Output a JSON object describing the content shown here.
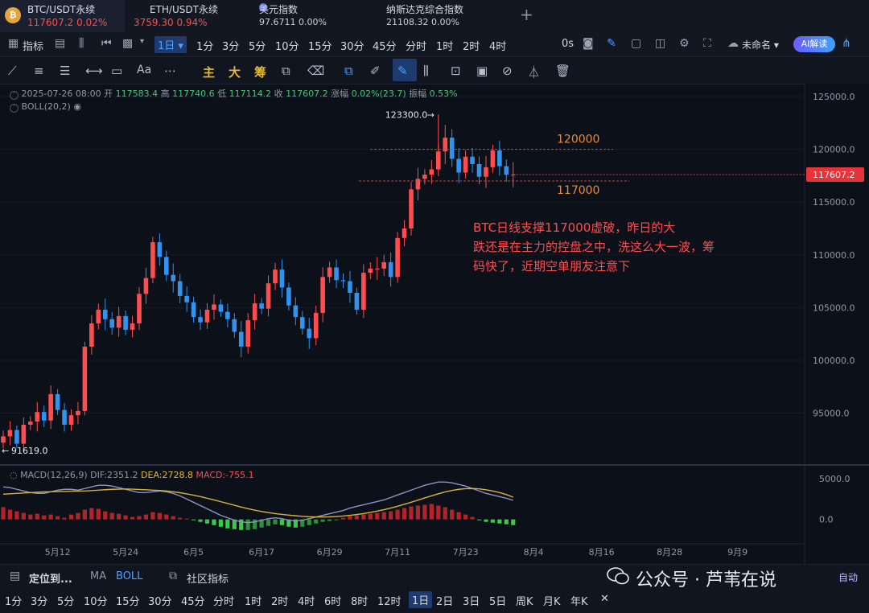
{
  "tabs": [
    {
      "name": "BTC/USDT永续",
      "price": "117607.2",
      "change": "0.02%",
      "color": "#ff4d4f",
      "icon": "bitcoin-icon"
    },
    {
      "name": "ETH/USDT永续",
      "price": "3759.30",
      "change": "0.94%",
      "color": "#ff4d4f"
    },
    {
      "name": "美元指数",
      "price": "97.6711",
      "change": "0.00%",
      "color": "#c9ced8"
    },
    {
      "name": "纳斯达克综合指数",
      "price": "21108.32",
      "change": "0.00%",
      "color": "#c9ced8"
    }
  ],
  "toolbar": {
    "indicator_label": "指标",
    "interval_selected": "1日",
    "intervals": [
      "1分",
      "3分",
      "5分",
      "10分",
      "15分",
      "30分",
      "45分",
      "分时",
      "1时",
      "2时",
      "4时"
    ],
    "zero_s": "0s",
    "layout_name": "未命名",
    "ai_label": "AI解读"
  },
  "drawbar": {
    "main": "主",
    "big": "大",
    "chips": "筹",
    "text_tool": "Aa"
  },
  "ohlc": {
    "date": "2025-07-26 08:00",
    "open_label": "开",
    "open": "117583.4",
    "high_label": "高",
    "high": "117740.6",
    "low_label": "低",
    "low": "117114.2",
    "close_label": "收",
    "close": "117607.2",
    "chg_label": "涨幅",
    "chg": "0.02%(23.7)",
    "amp_label": "振幅",
    "amp": "0.53%"
  },
  "boll_label": "BOLL(20,2)",
  "macd": {
    "label": "MACD(12,26,9)",
    "dif": "DIF:2351.2",
    "dea": "DEA:2728.8",
    "macd": "MACD:-755.1",
    "dea_color": "#e2b93b",
    "macd_color": "#ff4d4f"
  },
  "chart_data": {
    "type": "candlestick",
    "price_axis_ticks": [
      "125000.0",
      "120000.0",
      "115000.0",
      "110000.0",
      "105000.0",
      "100000.0",
      "95000.0"
    ],
    "price_axis_range": [
      91000,
      125000
    ],
    "current_price": "117607.2",
    "max_marker": "123300.0",
    "min_marker": "91619.0",
    "level_lines": [
      {
        "label": "120000",
        "value": 120000
      },
      {
        "label": "117000",
        "value": 117000
      }
    ],
    "annotation": "BTC日线支撑117000虚破，昨日的大跌还是在主力的控盘之中，洗这么大一波，筹码快了，近期空单朋友注意下",
    "x_ticks": [
      "5月12",
      "5月24",
      "6月5",
      "6月17",
      "6月29",
      "7月11",
      "7月23",
      "8月4",
      "8月16",
      "8月28",
      "9月9"
    ],
    "x_tick_index": [
      8,
      18,
      28,
      38,
      48,
      58,
      68,
      78,
      88,
      98,
      108
    ],
    "macd_axis_ticks": [
      "5000.0",
      "0.0"
    ],
    "macd_range": [
      -3000,
      6000
    ],
    "closes": [
      92800,
      93400,
      92100,
      93900,
      94200,
      95100,
      94300,
      96800,
      95300,
      93900,
      94800,
      95200,
      101300,
      103500,
      104800,
      103900,
      103100,
      104200,
      102900,
      103500,
      106300,
      107800,
      111200,
      109800,
      108100,
      107500,
      106100,
      105500,
      104100,
      103600,
      104800,
      105300,
      104600,
      103900,
      102700,
      101300,
      103800,
      105400,
      104900,
      107300,
      108600,
      106900,
      105200,
      104100,
      103000,
      102100,
      104500,
      107900,
      108800,
      107600,
      107500,
      106400,
      104800,
      108300,
      108700,
      108700,
      109300,
      107900,
      111600,
      112500,
      116200,
      117200,
      117600,
      118100,
      119800,
      121100,
      119100,
      117800,
      119300,
      118600,
      117400,
      118300,
      119900,
      118400,
      117583,
      117607
    ],
    "macd_hist": [
      1500,
      1200,
      1000,
      800,
      600,
      700,
      500,
      600,
      400,
      200,
      600,
      800,
      1200,
      1400,
      1300,
      1000,
      800,
      700,
      500,
      300,
      400,
      600,
      900,
      800,
      600,
      400,
      200,
      100,
      -100,
      -300,
      -500,
      -700,
      -900,
      -1100,
      -1200,
      -1300,
      -1300,
      -1200,
      -1000,
      -800,
      -600,
      -700,
      -900,
      -1000,
      -900,
      -700,
      -500,
      -300,
      -200,
      -100,
      200,
      400,
      500,
      600,
      700,
      800,
      900,
      1000,
      1200,
      1400,
      1600,
      1700,
      1800,
      1900,
      1700,
      1500,
      1200,
      900,
      600,
      300,
      -100,
      -300,
      -400,
      -500,
      -600,
      -700
    ],
    "dif": [
      4000,
      3900,
      3700,
      3500,
      3300,
      3200,
      3200,
      3400,
      3600,
      3700,
      3700,
      3600,
      3800,
      4000,
      4200,
      4200,
      4100,
      3900,
      3700,
      3500,
      3300,
      3300,
      3400,
      3500,
      3400,
      3200,
      2900,
      2500,
      2100,
      1700,
      1300,
      900,
      500,
      200,
      -100,
      -300,
      -400,
      -300,
      -100,
      100,
      200,
      100,
      -100,
      -200,
      -100,
      100,
      300,
      500,
      700,
      900,
      1100,
      1400,
      1600,
      1800,
      2000,
      2200,
      2400,
      2700,
      3000,
      3300,
      3600,
      3900,
      4200,
      4400,
      4600,
      4600,
      4500,
      4300,
      4100,
      3800,
      3500,
      3200,
      3000,
      2800,
      2600,
      2351
    ],
    "dea": [
      3100,
      3150,
      3200,
      3250,
      3300,
      3350,
      3380,
      3400,
      3420,
      3450,
      3470,
      3480,
      3500,
      3550,
      3600,
      3650,
      3700,
      3720,
      3740,
      3720,
      3680,
      3640,
      3600,
      3560,
      3500,
      3400,
      3280,
      3140,
      2980,
      2800,
      2600,
      2400,
      2180,
      1960,
      1740,
      1520,
      1320,
      1140,
      980,
      840,
      720,
      620,
      530,
      450,
      380,
      330,
      300,
      300,
      320,
      360,
      420,
      500,
      600,
      720,
      860,
      1020,
      1200,
      1400,
      1620,
      1860,
      2110,
      2370,
      2640,
      2900,
      3150,
      3380,
      3560,
      3700,
      3780,
      3800,
      3760,
      3650,
      3500,
      3300,
      3050,
      2729
    ]
  },
  "bottom": {
    "locate": "定位到...",
    "ma": "MA",
    "boll": "BOLL",
    "community": "社区指标",
    "auto": "自动",
    "intervals": [
      "1分",
      "3分",
      "5分",
      "10分",
      "15分",
      "30分",
      "45分",
      "分时",
      "1时",
      "2时",
      "4时",
      "6时",
      "8时",
      "12时",
      "1日",
      "2日",
      "3日",
      "5日",
      "周K",
      "月K",
      "年K"
    ],
    "selected": "1日"
  },
  "watermark": "公众号 · 芦苇在说",
  "colors": {
    "up": "#ff4d4f",
    "down": "#2f93ef",
    "bg": "#0c1019",
    "level": "#e88c3a",
    "annotation": "#ff4d4f"
  }
}
